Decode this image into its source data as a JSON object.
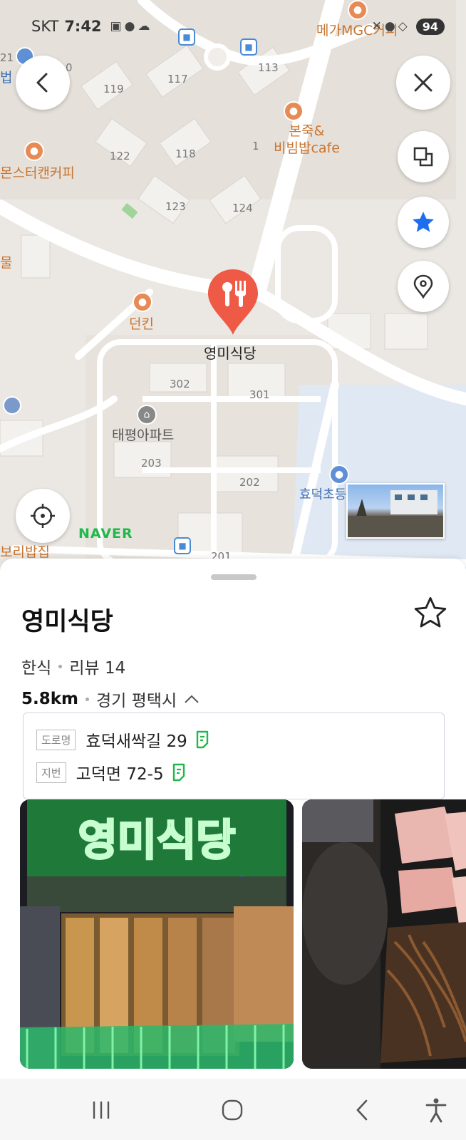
{
  "status_bar": {
    "carrier": "SKT",
    "time": "7:42",
    "battery": "94"
  },
  "map": {
    "watermark": "NAVER",
    "labels": {
      "block_119": "119",
      "block_117": "117",
      "block_113": "113",
      "block_122": "122",
      "block_118": "118",
      "block_123": "123",
      "block_124": "124",
      "block_302": "302",
      "block_301": "301",
      "block_203": "203",
      "block_202": "202",
      "block_201": "201",
      "block_21": "21",
      "block_10": "0",
      "block_1": "1",
      "poi_bonjuk": "본죽&\n비빔밥cafe",
      "poi_monster": "몬스터캔커피",
      "poi_mega": "메가MGC커피",
      "poi_dunkin": "던킨",
      "poi_taepyeong": "태평아파트",
      "poi_school": "효덕초등",
      "poi_bori": "보리밥집",
      "poi_mul": "물",
      "poi_beop": "법",
      "selected_place": "영미식당"
    }
  },
  "place": {
    "name": "영미식당",
    "category": "한식",
    "reviews": "리뷰 14",
    "distance": "5.8km",
    "region": "경기 평택시",
    "road_tag": "도로명",
    "road_address": "효덕새싹길 29",
    "lot_tag": "지번",
    "lot_address": "고덕면 72-5",
    "sign_text": "영미식당"
  },
  "colors": {
    "accent_blue": "#1e6ef0",
    "marker_red": "#ee5a45",
    "naver_green": "#1fb84a"
  },
  "icons": {
    "back": "chevron-left-icon",
    "close": "close-icon",
    "layers": "layers-icon",
    "favorite": "star-icon",
    "pin": "location-pin-icon",
    "my_location": "crosshair-icon"
  }
}
